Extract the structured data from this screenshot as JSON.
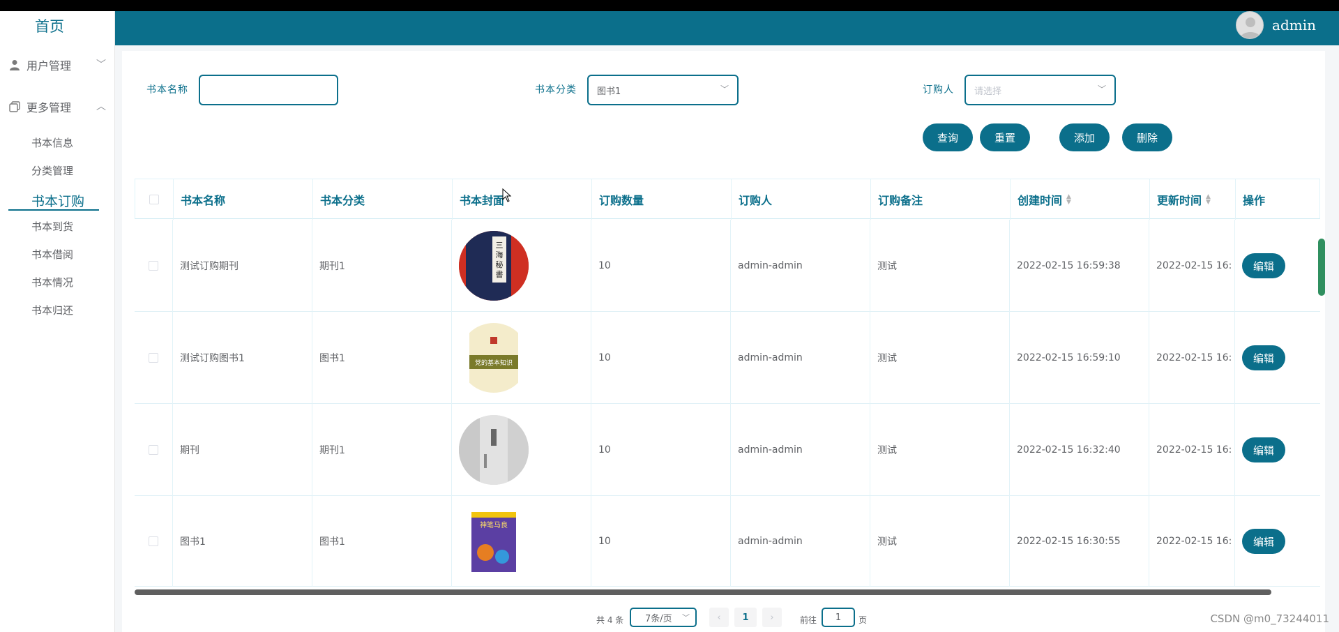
{
  "sidebar": {
    "home": "首页",
    "groups": [
      {
        "label": "用户管理",
        "icon": "user-icon",
        "expanded": false
      },
      {
        "label": "更多管理",
        "icon": "copy-icon",
        "expanded": true
      }
    ],
    "items": [
      "书本信息",
      "分类管理",
      "书本订购",
      "书本到货",
      "书本借阅",
      "书本情况",
      "书本归还"
    ],
    "active": "书本订购"
  },
  "header": {
    "username": "admin",
    "accent": "#0b6f8b"
  },
  "filters": {
    "name_label": "书本名称",
    "name_value": "",
    "category_label": "书本分类",
    "category_value": "图书1",
    "buyer_label": "订购人",
    "buyer_placeholder": "请选择"
  },
  "buttons": {
    "search": "查询",
    "reset": "重置",
    "add": "添加",
    "delete": "删除"
  },
  "table": {
    "columns": [
      "书本名称",
      "书本分类",
      "书本封面",
      "订购数量",
      "订购人",
      "订购备注",
      "创建时间",
      "更新时间",
      "操作"
    ],
    "rows": [
      {
        "name": "测试订购期刊",
        "category": "期刊1",
        "quantity": "10",
        "buyer": "admin-admin",
        "note": "测试",
        "created": "2022-02-15 16:59:38",
        "updated": "2022-02-15 16:",
        "action": "编辑"
      },
      {
        "name": "测试订购图书1",
        "category": "图书1",
        "quantity": "10",
        "buyer": "admin-admin",
        "note": "测试",
        "created": "2022-02-15 16:59:10",
        "updated": "2022-02-15 16:",
        "action": "编辑"
      },
      {
        "name": "期刊",
        "category": "期刊1",
        "quantity": "10",
        "buyer": "admin-admin",
        "note": "测试",
        "created": "2022-02-15 16:32:40",
        "updated": "2022-02-15 16:",
        "action": "编辑"
      },
      {
        "name": "图书1",
        "category": "图书1",
        "quantity": "10",
        "buyer": "admin-admin",
        "note": "测试",
        "created": "2022-02-15 16:30:55",
        "updated": "2022-02-15 16:",
        "action": "编辑"
      }
    ]
  },
  "pagination": {
    "total": "共 4 条",
    "page_size": "7条/页",
    "current": "1",
    "goto_prefix": "前往",
    "goto_value": "1",
    "goto_suffix": "页"
  },
  "watermark": "CSDN @m0_73244011"
}
